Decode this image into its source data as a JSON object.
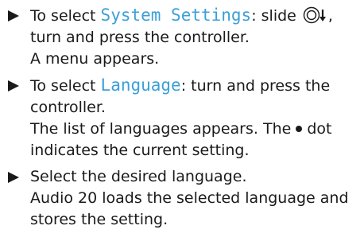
{
  "steps": [
    {
      "prefix": "To select ",
      "term": "System Settings",
      "after_term": ": slide",
      "icon": "controller-slide-down-icon",
      "after_icon": ",",
      "line2": "turn and press the controller.",
      "line3": "A menu appears."
    },
    {
      "prefix": "To select ",
      "term": "Language",
      "after_term": ": turn and press the",
      "line2": "controller.",
      "line3": "The list of languages appears. The",
      "dot_icon": "bullet-dot-icon",
      "line3_after": "dot",
      "line4": "indicates the current setting."
    },
    {
      "line1": "Select the desired language.",
      "line2": "Audio 20 loads the selected language and",
      "line3": "stores the setting."
    }
  ],
  "colors": {
    "display_term": "#3aa0d8",
    "text": "#1a1a1a"
  },
  "step_marker_icon": "play-triangle-icon"
}
